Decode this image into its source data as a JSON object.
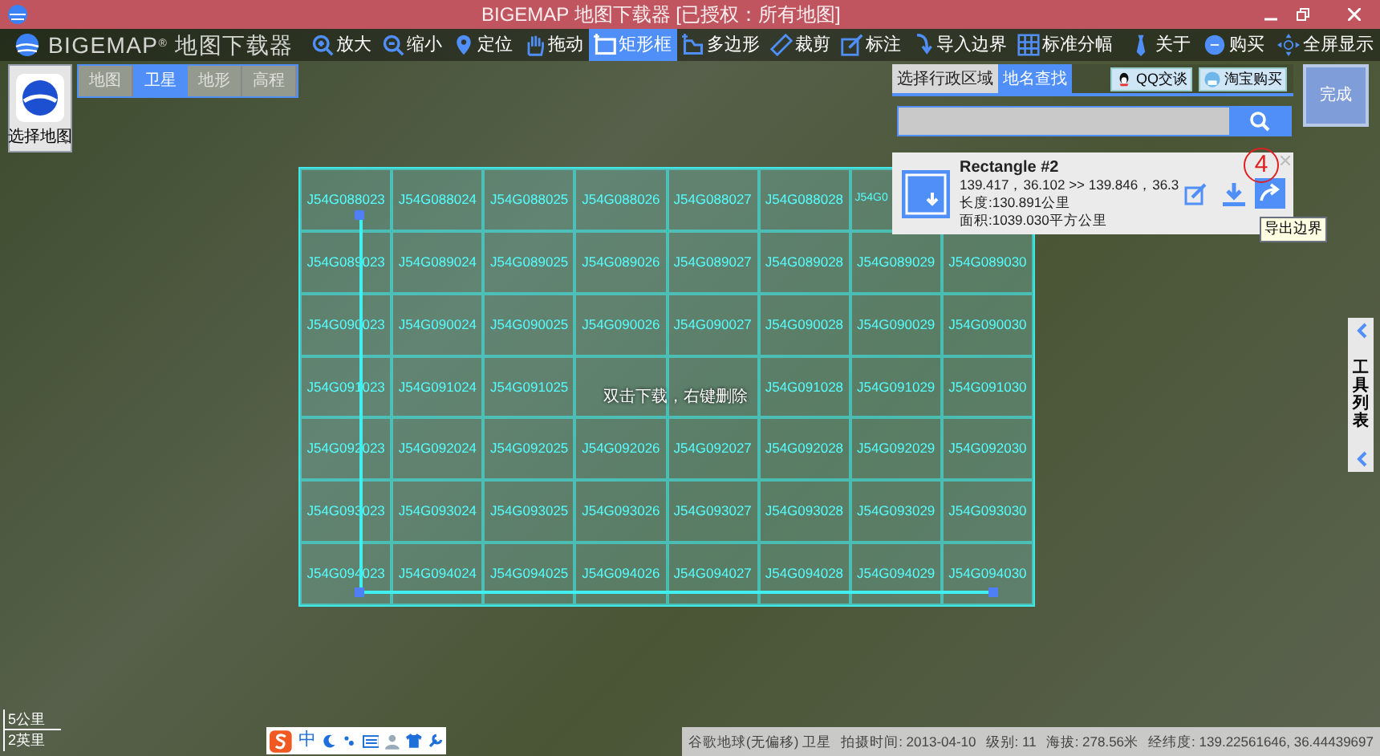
{
  "window": {
    "title": "BIGEMAP 地图下载器 [已授权：所有地图]"
  },
  "logo": {
    "name": "BIGEMAP",
    "mark": "®",
    "subtitle": "地图下载器"
  },
  "toolbar": [
    {
      "label": "放大",
      "selected": false
    },
    {
      "label": "缩小",
      "selected": false
    },
    {
      "label": "定位",
      "selected": false
    },
    {
      "label": "拖动",
      "selected": false
    },
    {
      "label": "矩形框",
      "selected": true
    },
    {
      "label": "多边形",
      "selected": false
    },
    {
      "label": "裁剪",
      "selected": false
    },
    {
      "label": "标注",
      "selected": false
    },
    {
      "label": "导入边界",
      "selected": false
    },
    {
      "label": "标准分幅",
      "selected": false
    }
  ],
  "toolbar_right": [
    "关于",
    "购买",
    "全屏显示"
  ],
  "map_selector": {
    "label": "选择地图"
  },
  "map_types": [
    {
      "label": "地图",
      "selected": false
    },
    {
      "label": "卫星",
      "selected": true
    },
    {
      "label": "地形",
      "selected": false
    },
    {
      "label": "高程",
      "selected": false
    }
  ],
  "search_panel": {
    "tabs": [
      {
        "label": "选择行政区域",
        "selected": false
      },
      {
        "label": "地名查找",
        "selected": true
      }
    ],
    "buttons": [
      "QQ交谈",
      "淘宝购买"
    ]
  },
  "done_button": {
    "label": "完成"
  },
  "selection": {
    "title": "Rectangle #2",
    "coords": "139.417，36.102 >> 139.846，36.3",
    "length": "长度:130.891公里",
    "area": "面积:1039.030平方公里",
    "tooltip": "导出边界",
    "callout": "4"
  },
  "tiles": {
    "hint": "双击下载，右键删除",
    "rows": [
      [
        "J54G088023",
        "J54G088024",
        "J54G088025",
        "J54G088026",
        "J54G088027",
        "J54G088028",
        "J54G0",
        null
      ],
      [
        "J54G089023",
        "J54G089024",
        "J54G089025",
        "J54G089026",
        "J54G089027",
        "J54G089028",
        "J54G089029",
        "J54G089030"
      ],
      [
        "J54G090023",
        "J54G090024",
        "J54G090025",
        "J54G090026",
        "J54G090027",
        "J54G090028",
        "J54G090029",
        "J54G090030"
      ],
      [
        "J54G091023",
        "J54G091024",
        "J54G091025",
        null,
        null,
        "J54G091028",
        "J54G091029",
        "J54G091030"
      ],
      [
        "J54G092023",
        "J54G092024",
        "J54G092025",
        "J54G092026",
        "J54G092027",
        "J54G092028",
        "J54G092029",
        "J54G092030"
      ],
      [
        "J54G093023",
        "J54G093024",
        "J54G093025",
        "J54G093026",
        "J54G093027",
        "J54G093028",
        "J54G093029",
        "J54G093030"
      ],
      [
        "J54G094023",
        "J54G094024",
        "J54G094025",
        "J54G094026",
        "J54G094027",
        "J54G094028",
        "J54G094029",
        "J54G094030"
      ]
    ]
  },
  "side_tab": {
    "label": "工具列表"
  },
  "scale": [
    "5公里",
    "2英里"
  ],
  "ime": {
    "label": "中"
  },
  "status_bar": [
    "谷歌地球(无偏移) 卫星",
    "拍摄时间: 2013-04-10",
    "级别: 11",
    "海拔: 278.56米",
    "经纬度: 139.22561646, 36.44439697"
  ]
}
